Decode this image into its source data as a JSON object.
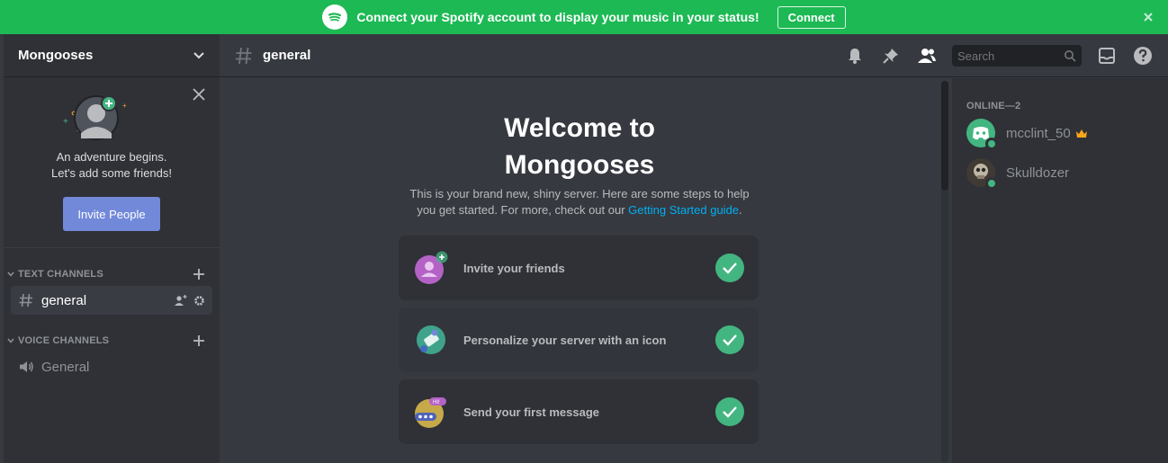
{
  "banner": {
    "message": "Connect your Spotify account to display your music in your status!",
    "connect_label": "Connect",
    "color": "#1db954"
  },
  "sidebar": {
    "server_name": "Mongooses",
    "invite_text_line1": "An adventure begins.",
    "invite_text_line2": "Let's add some friends!",
    "invite_button": "Invite People",
    "text_category": "TEXT CHANNELS",
    "voice_category": "VOICE CHANNELS",
    "text_channels": [
      {
        "name": "general",
        "icon": "hash-icon"
      }
    ],
    "voice_channels": [
      {
        "name": "General",
        "icon": "speaker-icon"
      }
    ]
  },
  "header": {
    "channel_name": "general",
    "search_placeholder": "Search",
    "icons": [
      "bell-icon",
      "pin-icon",
      "members-icon",
      "inbox-icon",
      "help-icon"
    ]
  },
  "welcome": {
    "title_line1": "Welcome to",
    "title_line2": "Mongooses",
    "sub_line1": "This is your brand new, shiny server. Here are some steps to help",
    "sub_line2_prefix": "you get started. For more, check out our ",
    "sub_link": "Getting Started guide",
    "sub_line2_suffix": ".",
    "steps": [
      {
        "label": "Invite your friends",
        "icon": "invite-friends-icon",
        "done": true
      },
      {
        "label": "Personalize your server with an icon",
        "icon": "personalize-icon",
        "done": true
      },
      {
        "label": "Send your first message",
        "icon": "message-icon",
        "done": true
      }
    ]
  },
  "members": {
    "heading": "ONLINE—2",
    "list": [
      {
        "name": "mcclint_50",
        "owner": true,
        "status": "online"
      },
      {
        "name": "Skulldozer",
        "owner": false,
        "status": "online"
      }
    ]
  },
  "colors": {
    "accent": "#7289da",
    "online": "#43b581",
    "link": "#00aff4"
  }
}
